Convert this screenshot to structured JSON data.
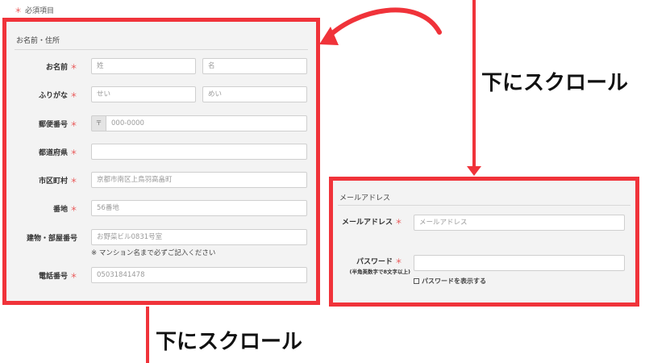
{
  "required_note": {
    "mark": "＊",
    "text": "必須項目"
  },
  "address_section": {
    "title": "お名前・住所",
    "fields": {
      "name": {
        "label": "お名前",
        "last_placeholder": "姓",
        "first_placeholder": "名"
      },
      "kana": {
        "label": "ふりがな",
        "last_placeholder": "せい",
        "first_placeholder": "めい"
      },
      "postal": {
        "label": "郵便番号",
        "prefix": "〒",
        "placeholder": "000-0000"
      },
      "prefecture": {
        "label": "都道府県",
        "value": ""
      },
      "city": {
        "label": "市区町村",
        "placeholder": "京都市南区上鳥羽高畠町"
      },
      "street": {
        "label": "番地",
        "placeholder": "56番地"
      },
      "building": {
        "label": "建物・部屋番号",
        "placeholder": "お野菜ビル0831号室",
        "hint": "※ マンション名まで必ずご記入ください"
      },
      "phone": {
        "label": "電話番号",
        "placeholder": "05031841478"
      }
    }
  },
  "account_section": {
    "title": "メールアドレス",
    "fields": {
      "email": {
        "label": "メールアドレス",
        "placeholder": "メールアドレス"
      },
      "password": {
        "label": "パスワード",
        "sublabel": "(半角英数字で8文字以上)",
        "value": "",
        "show_label": "パスワードを表示する"
      }
    }
  },
  "annotations": {
    "scroll_right": "下にスクロール",
    "scroll_bottom": "下にスクロール"
  },
  "colors": {
    "highlight": "#f0333a",
    "required": "#e84d4d",
    "panel": "#f3f3f3"
  }
}
